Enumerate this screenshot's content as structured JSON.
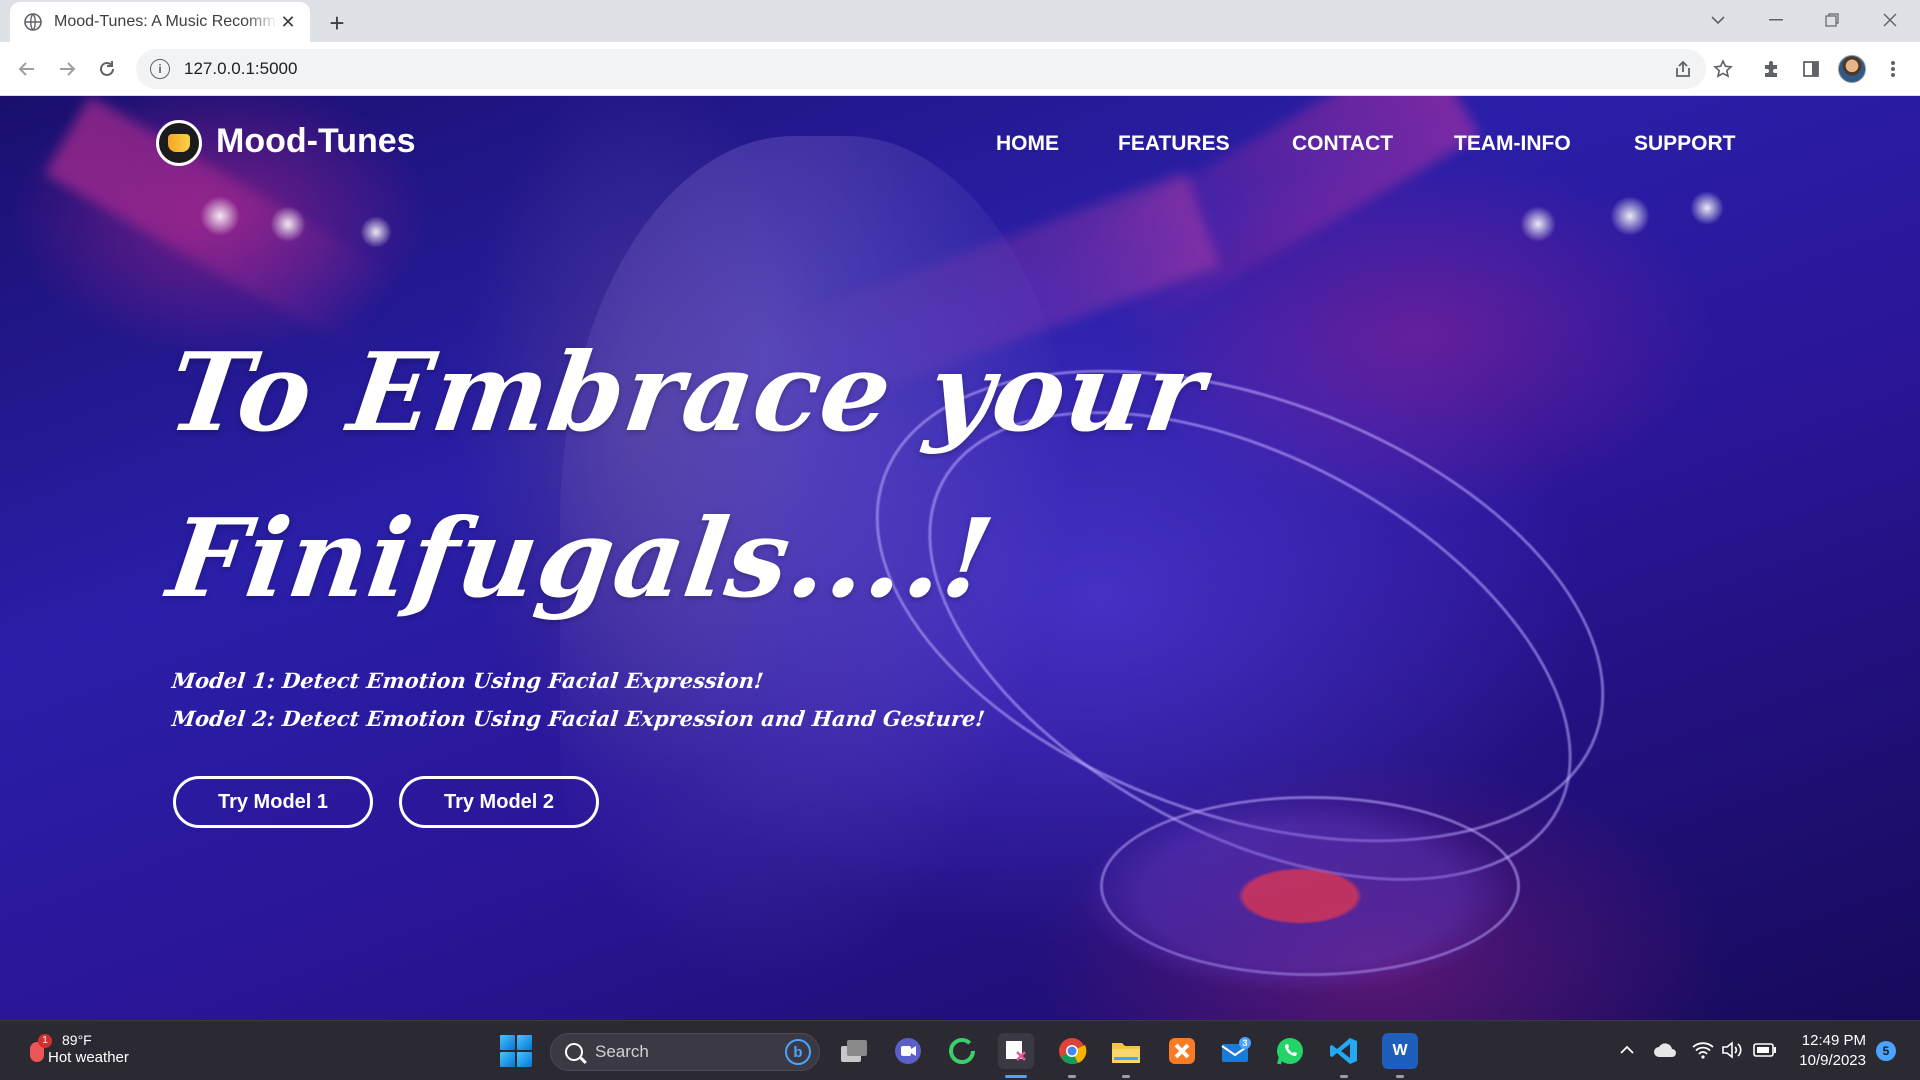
{
  "browser": {
    "tab_title": "Mood-Tunes: A Music Recommender",
    "url": "127.0.0.1:5000",
    "new_tab_label": "+",
    "tab_close_label": "✕"
  },
  "site": {
    "brand": "Mood-Tunes",
    "nav": [
      "HOME",
      "FEATURES",
      "CONTACT",
      "TEAM-INFO",
      "SUPPORT"
    ],
    "hero": {
      "line1": "To Embrace your",
      "line2": "Finifugals....!",
      "model1": "Model 1: Detect Emotion Using Facial Expression!",
      "model2": "Model 2: Detect Emotion Using Facial Expression and Hand Gesture!"
    },
    "buttons": {
      "try1": "Try Model 1",
      "try2": "Try Model 2"
    }
  },
  "taskbar": {
    "weather_temp": "89°F",
    "weather_desc": "Hot weather",
    "weather_badge": "1",
    "search_placeholder": "Search",
    "mail_badge": "3",
    "word_label": "W",
    "time": "12:49 PM",
    "date": "10/9/2023",
    "notif_count": "5"
  }
}
